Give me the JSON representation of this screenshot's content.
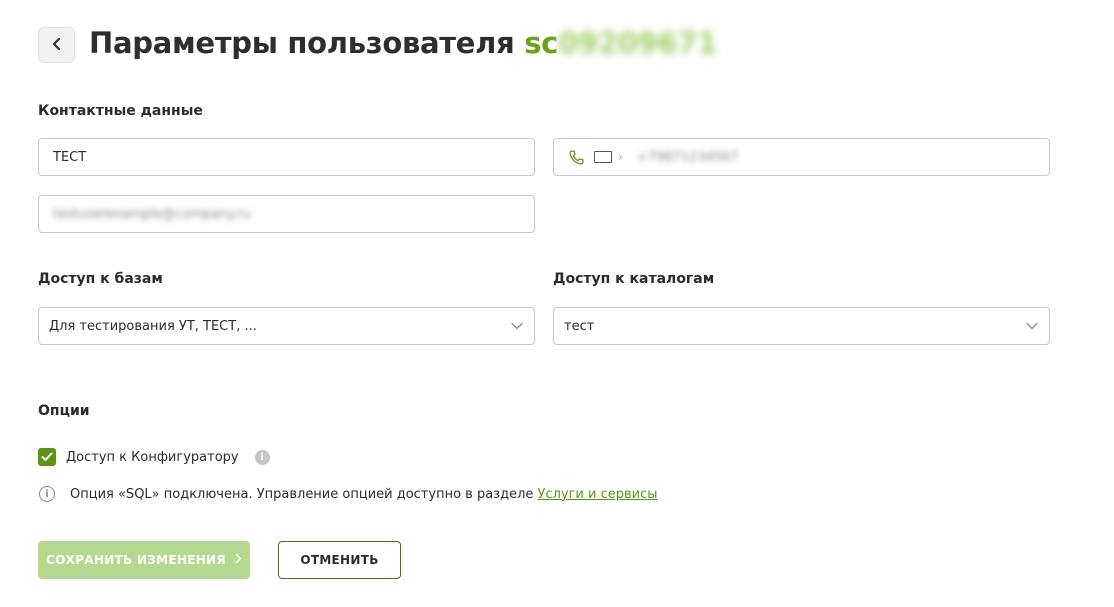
{
  "header": {
    "back_icon": "chevron-left-icon",
    "title": "Параметры пользователя",
    "user_id_prefix": "sc",
    "user_id_rest": "09209671"
  },
  "contacts": {
    "section_title": "Контактные данные",
    "name_value": "ТЕСТ",
    "phone_icon": "phone-icon",
    "flag_icon": "flag-icon",
    "phone_value": "+79871234567",
    "email_value": "testuserexample@company.ru"
  },
  "access": {
    "bases_title": "Доступ к базам",
    "bases_value": "Для тестирования УТ, ТЕСТ, ...",
    "catalogs_title": "Доступ к каталогам",
    "catalogs_value": "тест"
  },
  "options": {
    "section_title": "Опции",
    "configurator_label": "Доступ к Конфигуратору",
    "configurator_checked": true,
    "note_text": "Опция «SQL» подключена. Управление опцией доступно в разделе ",
    "note_link": "Услуги и сервисы"
  },
  "actions": {
    "save_label": "СОХРАНИТЬ ИЗМЕНЕНИЯ",
    "cancel_label": "ОТМЕНИТЬ"
  },
  "colors": {
    "accent": "#5a9614",
    "accent_disabled": "#b4d990",
    "text": "#2b2b2b",
    "border": "#c9c9c9"
  }
}
